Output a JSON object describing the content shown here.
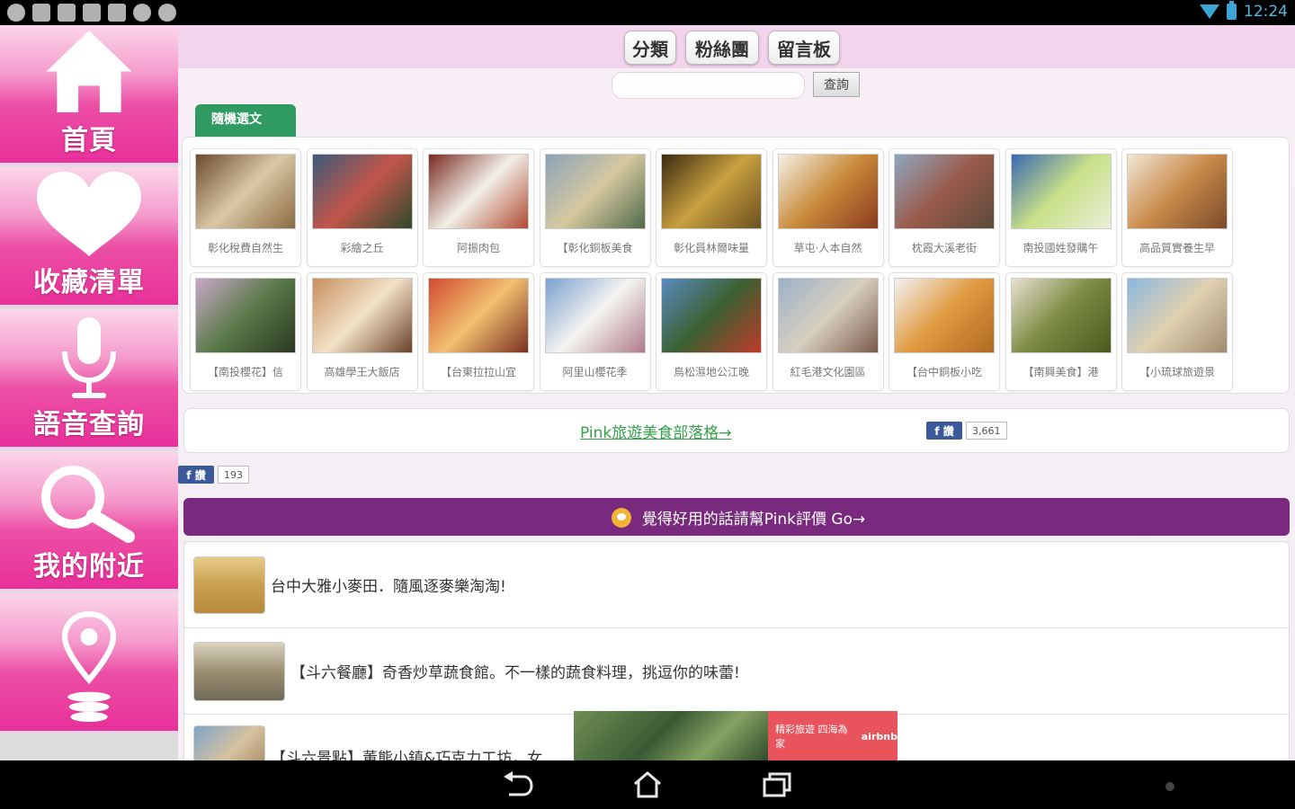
{
  "status_bar": {
    "time": "12:24",
    "notification_icons": [
      "android-icon",
      "gallery-icon",
      "upload-icon",
      "image-icon",
      "upload-icon",
      "chat-icon",
      "chat-icon"
    ]
  },
  "sidebar": {
    "items": [
      {
        "label": "首頁",
        "icon": "home-icon"
      },
      {
        "label": "收藏清單",
        "icon": "heart-icon"
      },
      {
        "label": "語音查詢",
        "icon": "microphone-icon"
      },
      {
        "label": "我的附近",
        "icon": "search-icon"
      },
      {
        "label": "",
        "icon": "map-pin-icon"
      }
    ]
  },
  "header": {
    "tabs": [
      "分類",
      "粉絲團",
      "留言板"
    ]
  },
  "search": {
    "placeholder": "",
    "button_label": "查詢"
  },
  "random": {
    "tab_label": "隨機選文",
    "thumbnails": [
      {
        "caption": "彰化稅費自然生"
      },
      {
        "caption": "彩繪之丘"
      },
      {
        "caption": "阿振肉包"
      },
      {
        "caption": "【彰化銅板美食"
      },
      {
        "caption": "彰化員林爾味量"
      },
      {
        "caption": "草屯·人本自然"
      },
      {
        "caption": "枕霞大溪老街"
      },
      {
        "caption": "南投國姓發購午"
      },
      {
        "caption": "高品質實養生早"
      },
      {
        "caption": "【南投櫻花】信"
      },
      {
        "caption": "高雄學王大飯店"
      },
      {
        "caption": "【台東拉拉山宜"
      },
      {
        "caption": "阿里山櫻花季"
      },
      {
        "caption": "鳥松濕地公江晚"
      },
      {
        "caption": "紅毛港文化園區"
      },
      {
        "caption": "【台中銅板小吃"
      },
      {
        "caption": "【南興美食】港"
      },
      {
        "caption": "【小琉球旅遊景"
      }
    ]
  },
  "blog": {
    "link_text": "Pink旅遊美食部落格→",
    "like_label": "f 讚",
    "like_count": "3,661"
  },
  "page_like": {
    "like_label": "f 讚",
    "like_count": "193"
  },
  "rate_banner": {
    "text": "覺得好用的話請幫Pink評價 Go→"
  },
  "articles": [
    {
      "title": "台中大雅小麥田．隨風逐麥樂淘淘!"
    },
    {
      "title": "【斗六餐廳】奇香炒草蔬食館。不一樣的蔬食料理，挑逗你的味蕾!"
    },
    {
      "title": "【斗六景點】董熊小鎮&巧克力工坊，女"
    }
  ],
  "ad": {
    "text": "精彩旅遊 四海為家",
    "brand": "airbnb"
  },
  "nav_bar": {
    "buttons": [
      "back-icon",
      "home-icon",
      "recent-apps-icon"
    ]
  }
}
